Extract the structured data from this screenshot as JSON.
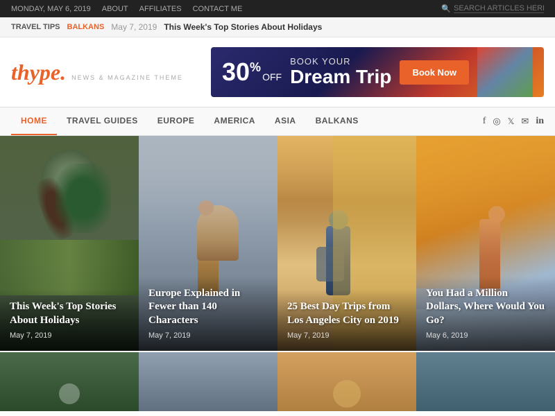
{
  "topbar": {
    "date": "MONDAY, MAY 6, 2019",
    "links": [
      "ABOUT",
      "AFFILIATES",
      "CONTACT ME"
    ],
    "search_placeholder": "SEARCH ARTICLES HERE..."
  },
  "ticker": {
    "label": "TRAVEL TIPS",
    "tag": "BALKANS",
    "date": "May 7, 2019",
    "title": "This Week's Top Stories About Holidays"
  },
  "header": {
    "logo": "thype.",
    "tagline": "NEWS & MAGAZINE THEME"
  },
  "ad": {
    "discount": "30",
    "discount_suffix": "%",
    "off_label": "OFF",
    "book_label": "BOOK YOUR",
    "dream_label": "Dream Trip",
    "cta": "Book Now"
  },
  "nav": {
    "items": [
      {
        "label": "HOME",
        "active": true
      },
      {
        "label": "TRAVEL GUIDES",
        "active": false
      },
      {
        "label": "EUROPE",
        "active": false
      },
      {
        "label": "AMERICA",
        "active": false
      },
      {
        "label": "ASIA",
        "active": false
      },
      {
        "label": "BALKANS",
        "active": false
      }
    ],
    "social": [
      "f",
      "◉",
      "𝕏",
      "✉",
      "in"
    ]
  },
  "cards": [
    {
      "title": "This Week's Top Stories About Holidays",
      "date": "May 7, 2019"
    },
    {
      "title": "Europe Explained in Fewer than 140 Characters",
      "date": "May 7, 2019"
    },
    {
      "title": "25 Best Day Trips from Los Angeles City on 2019",
      "date": "May 7, 2019"
    },
    {
      "title": "You Had a Million Dollars, Where Would You Go?",
      "date": "May 6, 2019"
    }
  ]
}
